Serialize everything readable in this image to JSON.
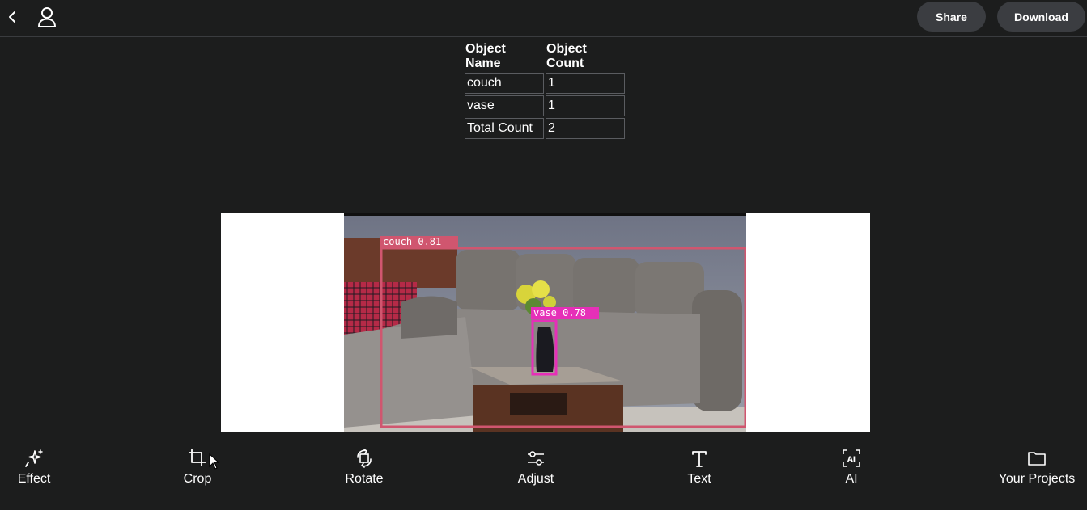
{
  "header": {
    "share_label": "Share",
    "download_label": "Download"
  },
  "detection_table": {
    "headers": [
      "Object Name",
      "Object Count"
    ],
    "rows": [
      {
        "name": "couch",
        "count": "1"
      },
      {
        "name": "vase",
        "count": "1"
      },
      {
        "name": "Total Count",
        "count": "2"
      }
    ]
  },
  "image": {
    "detections": [
      {
        "label": "couch 0.81",
        "color": "#d0566f"
      },
      {
        "label": "vase 0.78",
        "color": "#e62fb8"
      }
    ]
  },
  "toolbar": {
    "items": [
      {
        "label": "Effect",
        "icon": "sparkle-icon"
      },
      {
        "label": "Crop",
        "icon": "crop-icon"
      },
      {
        "label": "Rotate",
        "icon": "rotate-icon"
      },
      {
        "label": "Adjust",
        "icon": "sliders-icon"
      },
      {
        "label": "Text",
        "icon": "text-icon"
      },
      {
        "label": "AI",
        "icon": "ai-icon"
      },
      {
        "label": "Your Projects",
        "icon": "folder-icon"
      }
    ]
  }
}
